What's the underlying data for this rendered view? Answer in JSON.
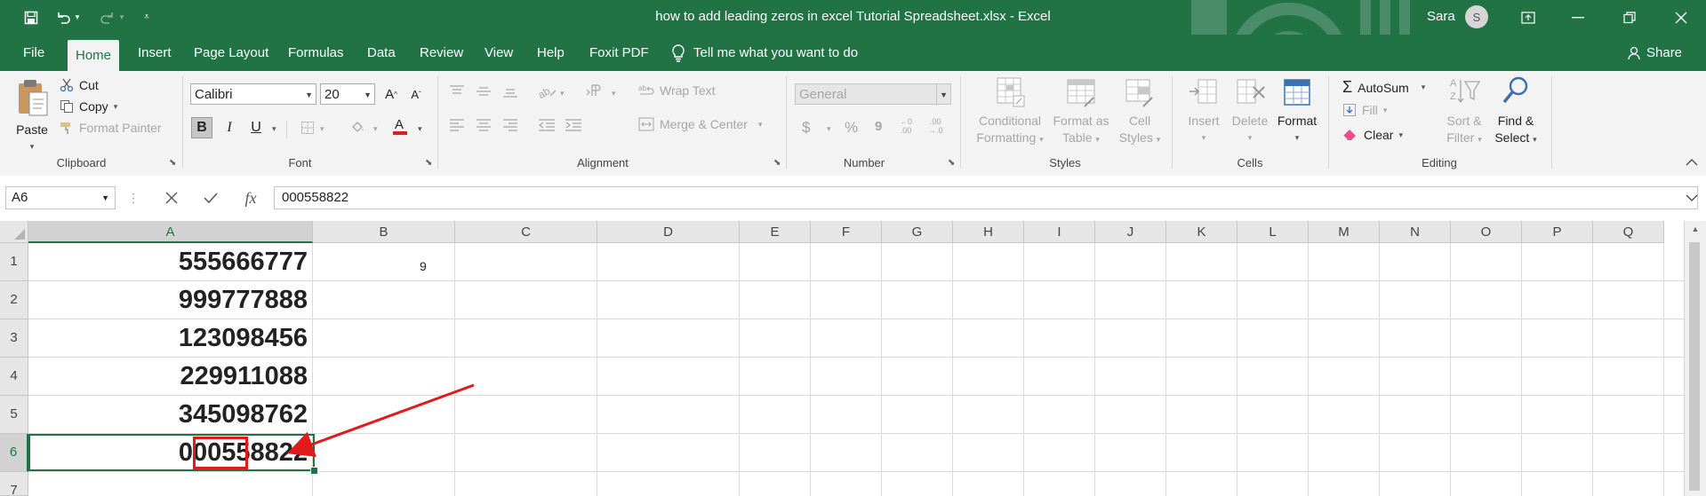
{
  "window": {
    "title": "how to add leading zeros in excel Tutorial Spreadsheet.xlsx  -  Excel",
    "user": "Sara",
    "avatar_initial": "S"
  },
  "colors": {
    "brand": "#217346",
    "annotation": "#e01b1b"
  },
  "quick_access": [
    "save-icon",
    "undo-icon",
    "redo-icon",
    "customize-icon"
  ],
  "tabs": [
    "File",
    "Home",
    "Insert",
    "Page Layout",
    "Formulas",
    "Data",
    "Review",
    "View",
    "Help",
    "Foxit PDF"
  ],
  "active_tab": "Home",
  "tell_me": "Tell me what you want to do",
  "share": "Share",
  "ribbon": {
    "clipboard": {
      "paste": "Paste",
      "cut": "Cut",
      "copy": "Copy",
      "format_painter": "Format Painter",
      "label": "Clipboard"
    },
    "font": {
      "name": "Calibri",
      "size": "20",
      "bold": "B",
      "italic": "I",
      "underline": "U",
      "label": "Font"
    },
    "alignment": {
      "wrap_text": "Wrap Text",
      "merge_center": "Merge & Center",
      "label": "Alignment"
    },
    "number": {
      "format": "General",
      "label": "Number"
    },
    "styles": {
      "conditional_1": "Conditional",
      "conditional_2": "Formatting",
      "format_table_1": "Format as",
      "format_table_2": "Table",
      "cell_styles_1": "Cell",
      "cell_styles_2": "Styles",
      "label": "Styles"
    },
    "cells": {
      "insert": "Insert",
      "delete": "Delete",
      "format": "Format",
      "label": "Cells"
    },
    "editing": {
      "autosum": "AutoSum",
      "fill": "Fill",
      "clear": "Clear",
      "sort_1": "Sort &",
      "sort_2": "Filter",
      "find_1": "Find &",
      "find_2": "Select",
      "label": "Editing"
    }
  },
  "formula_bar": {
    "name_box": "A6",
    "formula": "000558822"
  },
  "columns": [
    "A",
    "B",
    "C",
    "D",
    "E",
    "F",
    "G",
    "H",
    "I",
    "J",
    "K",
    "L",
    "M",
    "N",
    "O",
    "P",
    "Q"
  ],
  "rows": [
    "1",
    "2",
    "3",
    "4",
    "5",
    "6",
    "7"
  ],
  "cells": {
    "A1": "555666777",
    "A2": "999777888",
    "A3": "123098456",
    "A4": "229911088",
    "A5": "345098762",
    "A6": "000558822",
    "B1": "9"
  },
  "selected_cell": "A6"
}
